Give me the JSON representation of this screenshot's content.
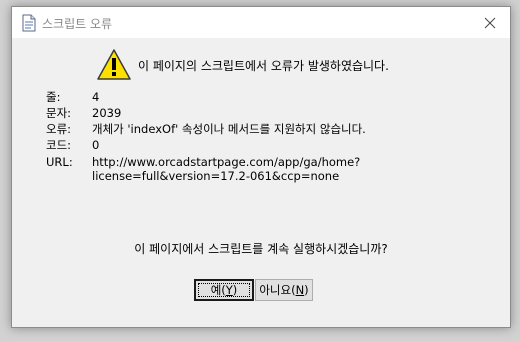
{
  "window": {
    "title": "스크립트 오류"
  },
  "message": "이 페이지의 스크립트에서 오류가 발생하였습니다.",
  "details": [
    {
      "label": "줄:",
      "value": "4"
    },
    {
      "label": "문자:",
      "value": "2039"
    },
    {
      "label": "오류:",
      "value": "개체가 'indexOf' 속성이나 메서드를 지원하지 않습니다."
    },
    {
      "label": "코드:",
      "value": "0"
    },
    {
      "label": "URL:",
      "value": "http://www.orcadstartpage.com/app/ga/home?",
      "value2": "license=full&version=17.2-061&ccp=none"
    }
  ],
  "question": "이 페이지에서 스크립트를 계속 실행하시겠습니까?",
  "buttons": {
    "yes": {
      "text": "예(",
      "key": "Y",
      "end": ")"
    },
    "no": {
      "text": "아니요(",
      "key": "N",
      "end": ")"
    }
  },
  "icons": {
    "title": "document-icon",
    "warning": "warning-icon",
    "close": "close-icon"
  },
  "colors": {
    "warning_fill": "#fce100",
    "title_text": "#888888"
  }
}
